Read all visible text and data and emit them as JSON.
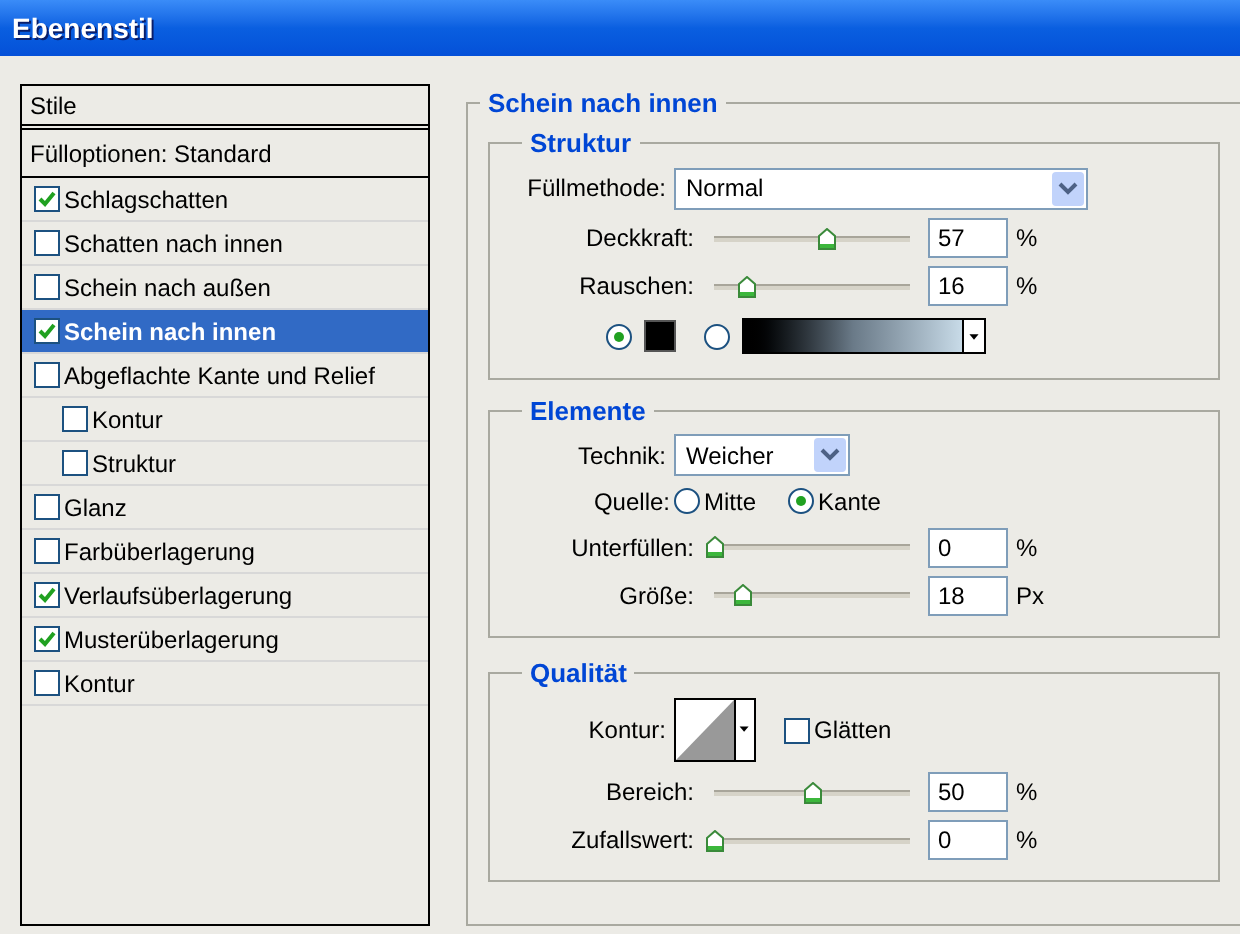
{
  "window": {
    "title": "Ebenenstil"
  },
  "styles_list": {
    "header": "Stile",
    "options": "Fülloptionen: Standard",
    "items": [
      {
        "label": "Schlagschatten",
        "checked": true,
        "selected": false
      },
      {
        "label": "Schatten nach innen",
        "checked": false,
        "selected": false
      },
      {
        "label": "Schein nach außen",
        "checked": false,
        "selected": false
      },
      {
        "label": "Schein nach innen",
        "checked": true,
        "selected": true
      },
      {
        "label": "Abgeflachte Kante und Relief",
        "checked": false,
        "selected": false,
        "children": [
          {
            "label": "Kontur",
            "checked": false,
            "selected": false
          },
          {
            "label": "Struktur",
            "checked": false,
            "selected": false
          }
        ]
      },
      {
        "label": "Glanz",
        "checked": false,
        "selected": false
      },
      {
        "label": "Farbüberlagerung",
        "checked": false,
        "selected": false
      },
      {
        "label": "Verlaufsüberlagerung",
        "checked": true,
        "selected": false
      },
      {
        "label": "Musterüberlagerung",
        "checked": true,
        "selected": false
      },
      {
        "label": "Kontur",
        "checked": false,
        "selected": false
      }
    ]
  },
  "panel": {
    "title": "Schein nach innen",
    "struktur": {
      "title": "Struktur",
      "blend_label": "Füllmethode:",
      "blend_value": "Normal",
      "sliders": [
        {
          "label": "Deckkraft:",
          "level": 0.57,
          "value": "57",
          "unit": "%"
        },
        {
          "label": "Rauschen:",
          "level": 0.16,
          "value": "16",
          "unit": "%"
        }
      ],
      "fill_choices": [
        {
          "kind": "color",
          "selected": true
        },
        {
          "kind": "gradient",
          "selected": false
        }
      ]
    },
    "elemente": {
      "title": "Elemente",
      "technique_label": "Technik:",
      "technique_value": "Weicher",
      "source_label": "Quelle:",
      "sources": [
        {
          "label": "Mitte",
          "selected": false
        },
        {
          "label": "Kante",
          "selected": true
        }
      ],
      "sliders": [
        {
          "label": "Unterfüllen:",
          "level": 0,
          "value": "0",
          "unit": "%"
        },
        {
          "label": "Größe:",
          "level": 0.14,
          "value": "18",
          "unit": "Px"
        }
      ]
    },
    "qualitaet": {
      "title": "Qualität",
      "contour_label": "Kontur:",
      "antialias": {
        "label": "Glätten",
        "checked": false
      },
      "sliders": [
        {
          "label": "Bereich:",
          "level": 0.5,
          "value": "50",
          "unit": "%"
        },
        {
          "label": "Zufallswert:",
          "level": 0,
          "value": "0",
          "unit": "%"
        }
      ]
    }
  }
}
